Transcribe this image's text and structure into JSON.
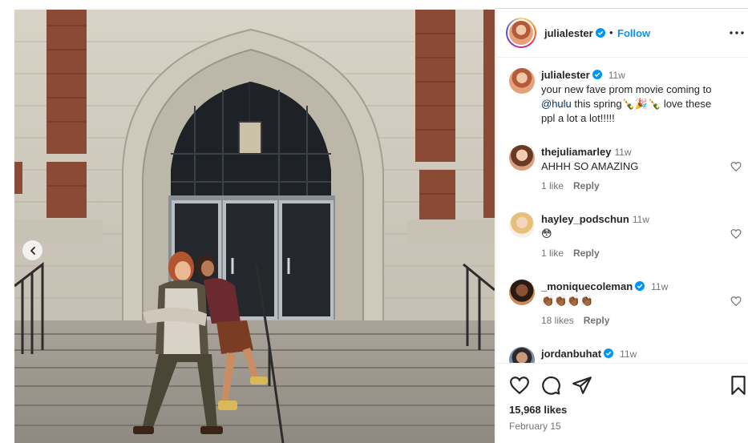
{
  "post": {
    "username": "julialester",
    "follow_label": "Follow",
    "separator": "•",
    "caption_time": "11w",
    "caption_line1": "your new fave prom movie coming to",
    "caption_mention": "@hulu",
    "caption_line2_rest": " this spring🍾🎉🍾 love these",
    "caption_line3": "ppl a lot a lot!!!!!",
    "likes": "15,968 likes",
    "date": "February 15"
  },
  "comments": [
    {
      "username": "thejuliamarley",
      "time": "11w",
      "text": "AHHH SO AMAZING",
      "likes": "1 like",
      "reply": "Reply",
      "verified": false
    },
    {
      "username": "hayley_podschun",
      "time": "11w",
      "text": "😳",
      "likes": "1 like",
      "reply": "Reply",
      "verified": false
    },
    {
      "username": "_moniquecoleman",
      "time": "11w",
      "text": "👏🏾👏🏾👏🏾👏🏾",
      "likes": "18 likes",
      "reply": "Reply",
      "verified": true
    },
    {
      "username": "jordanbuhat",
      "time": "11w",
      "text": "",
      "likes": "",
      "reply": "",
      "verified": true
    }
  ],
  "icons": [
    "more-options-icon",
    "verified-badge-icon",
    "heart-icon",
    "comment-icon",
    "share-icon",
    "bookmark-icon",
    "carousel-prev-icon"
  ],
  "colors": {
    "accent": "#0095f6",
    "verified": "#0095f6",
    "text": "#262626",
    "muted": "#737373"
  }
}
